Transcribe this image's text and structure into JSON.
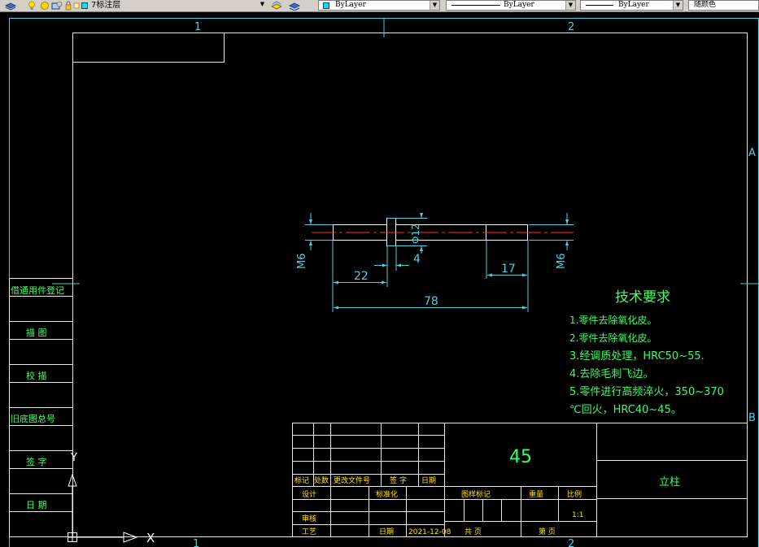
{
  "toolbar": {
    "layer_name": "7标注层",
    "color_value": "ByLayer",
    "linetype_value": "ByLayer",
    "lineweight_value": "ByLayer",
    "plotstyle_value": "随颜色"
  },
  "drawing": {
    "zone_labels": {
      "col1": "1",
      "col2": "2",
      "rowA": "A",
      "rowB": "B"
    },
    "dimensions": {
      "d22": "22",
      "d4": "4",
      "d17": "17",
      "d78": "78",
      "dia12": "Φ12",
      "m6_left": "M6",
      "m6_right": "M6"
    },
    "tech_req": {
      "title": "技术要求",
      "lines": [
        "1.零件去除氧化皮。",
        "2.零件去除氧化皮。",
        "3.经调质处理，HRC50~55.",
        "4.去除毛刺飞边。",
        "5.零件进行高频淬火，350~370",
        "℃回火，HRC40~45。"
      ]
    },
    "side_table": [
      "借通用件登记",
      "描 图",
      "校 描",
      "旧底图总号",
      "签 字",
      "日 期"
    ],
    "title_block": {
      "material": "45",
      "part_name": "立柱",
      "row_labels": [
        "标记",
        "处数",
        "更改文件号",
        "签 字",
        "日期"
      ],
      "design": "设计",
      "standardize": "标准化",
      "review": "审核",
      "process": "工艺",
      "date_label": "日期",
      "date_value": "2021-12-08",
      "stage_mark": "图样标记",
      "weight": "重量",
      "scale_label": "比例",
      "scale_value": "1:1",
      "total_sheets": "共 页",
      "sheet_no": "第 页"
    },
    "ucs": {
      "x": "X",
      "y": "Y"
    }
  }
}
